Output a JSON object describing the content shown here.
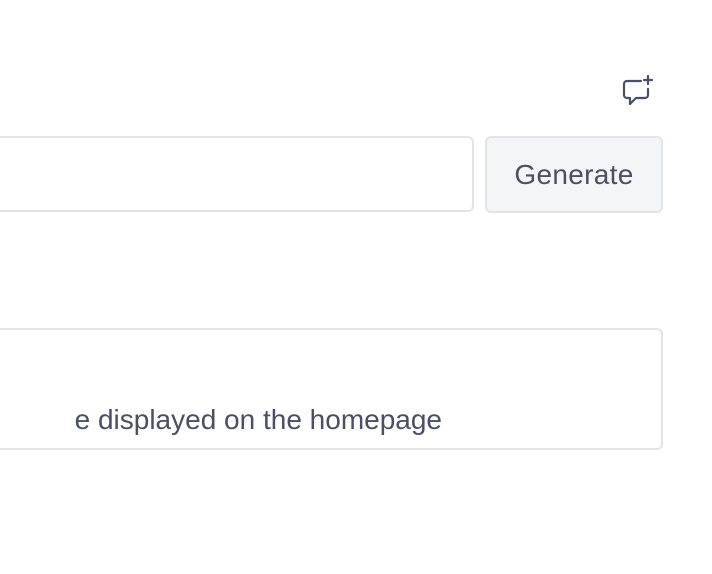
{
  "header": {
    "feedback_icon": "add-comment-icon"
  },
  "generator": {
    "input_value": "",
    "button_label": "Generate"
  },
  "info_box": {
    "text": "e displayed on the homepage"
  },
  "colors": {
    "text": "#4a4f63",
    "border": "#e3e4e8",
    "button_bg": "#f4f5f7",
    "background": "#ffffff"
  }
}
